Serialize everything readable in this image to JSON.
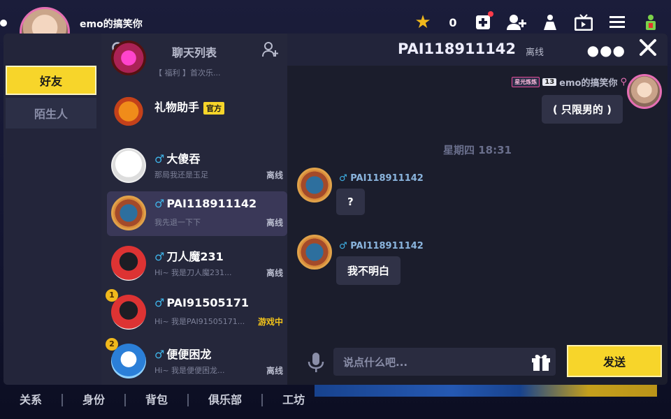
{
  "topbar": {
    "username": "emo的搞笑你",
    "coin_count": "0"
  },
  "bottomnav": [
    "关系",
    "身份",
    "背包",
    "俱乐部",
    "工坊"
  ],
  "tabs": {
    "friends": "好友",
    "strangers": "陌生人"
  },
  "list": {
    "title": "聊天列表",
    "partial_item": {
      "msg": "【 福利 】首次乐..."
    },
    "items": [
      {
        "name": "礼物助手",
        "official": "官方",
        "msg": "",
        "status": "",
        "gender": ""
      },
      {
        "name": "大傻吞",
        "gender": "♂",
        "msg": "那局我还是玉足",
        "status": "离线"
      },
      {
        "name": "PAI118911142",
        "gender": "♂",
        "msg": "我先退一下下",
        "status": "离线",
        "selected": true
      },
      {
        "name": "刀人魔231",
        "gender": "♂",
        "msg": "Hi~ 我是刀人魔231...",
        "status": "离线"
      },
      {
        "name": "PAI91505171",
        "gender": "♂",
        "msg": "Hi~ 我是PAI91505171...",
        "status": "游戏中",
        "rank": "1"
      },
      {
        "name": "便便困龙",
        "gender": "♂",
        "msg": "Hi~ 我是便便困龙...",
        "status": "离线",
        "rank": "2"
      }
    ]
  },
  "chat": {
    "title": "PAI118911142",
    "status": "离线",
    "self": {
      "star_badge": "星光炼炼",
      "level": "13",
      "name": "emo的搞笑你",
      "message": "( 只限男的 )"
    },
    "date_separator": "星期四 18:31",
    "messages": [
      {
        "sender": "PAI118911142",
        "gender": "♂",
        "text": "?"
      },
      {
        "sender": "PAI118911142",
        "gender": "♂",
        "text": "我不明白"
      }
    ],
    "input_placeholder": "说点什么吧...",
    "send_label": "发送"
  },
  "colors": {
    "accent_yellow": "#f7d52a",
    "male_blue": "#3fb3e8",
    "in_game": "#f2c31a",
    "panel": "#1c1e2e"
  }
}
